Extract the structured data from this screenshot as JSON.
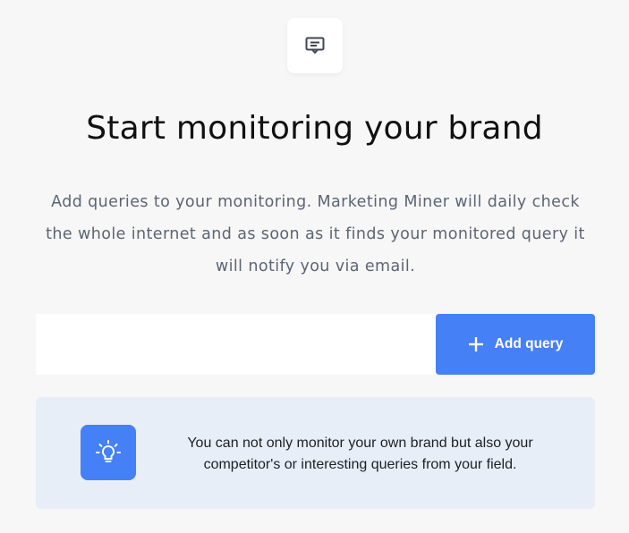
{
  "header": {
    "icon": "message-square-icon",
    "title": "Start monitoring your brand"
  },
  "description": "Add queries to your monitoring. Marketing Miner will daily check the whole internet and as soon as it finds your monitored query it will notify you via email.",
  "query_form": {
    "input_value": "",
    "input_placeholder": "",
    "add_button_label": "Add query",
    "add_button_icon": "plus-icon"
  },
  "tip": {
    "icon": "lightbulb-icon",
    "text": "You can not only monitor your own brand but also your competitor's or interesting queries from your field."
  },
  "colors": {
    "background": "#f7f7f7",
    "accent": "#4580f7",
    "tip_background": "#e8eef8",
    "description_text": "#5b6575"
  }
}
